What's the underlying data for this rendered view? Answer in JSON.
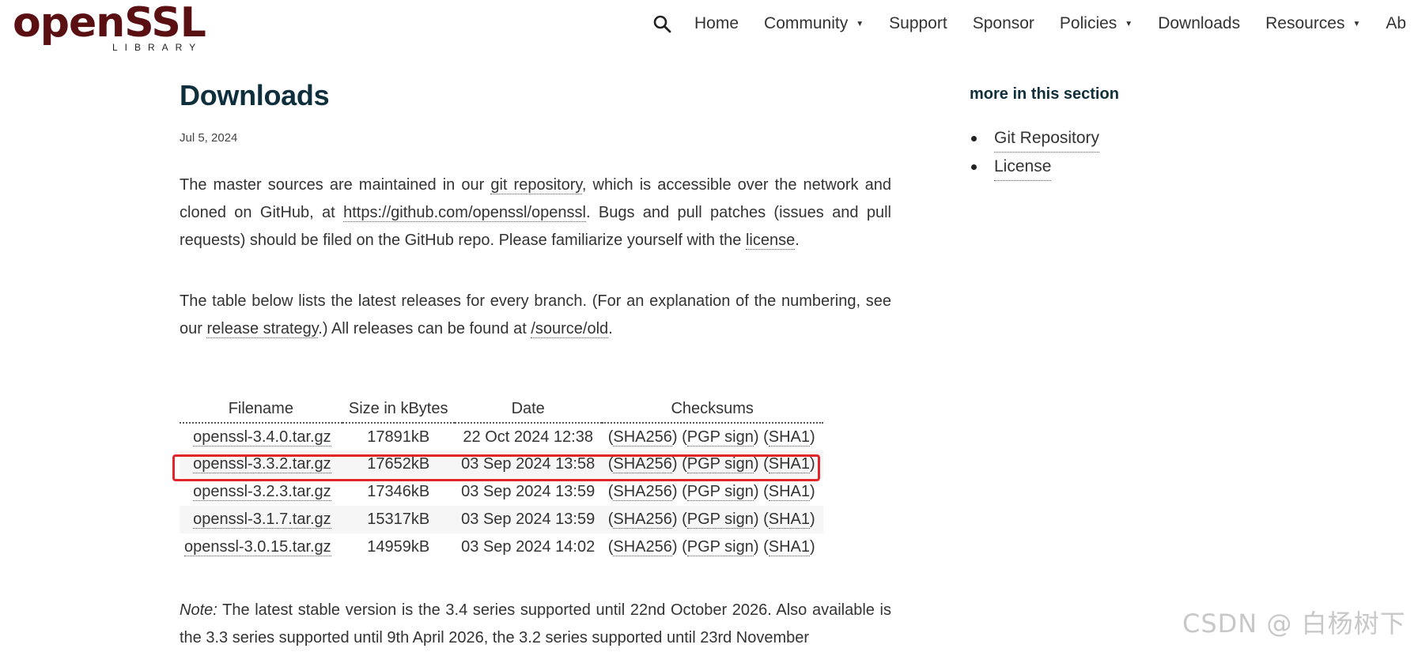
{
  "header": {
    "logo": {
      "text": "openSSL",
      "subtext": "LIBRARY"
    },
    "nav": [
      {
        "label": "Home",
        "dropdown": false
      },
      {
        "label": "Community",
        "dropdown": true
      },
      {
        "label": "Support",
        "dropdown": false
      },
      {
        "label": "Sponsor",
        "dropdown": false
      },
      {
        "label": "Policies",
        "dropdown": true
      },
      {
        "label": "Downloads",
        "dropdown": false
      },
      {
        "label": "Resources",
        "dropdown": true
      },
      {
        "label": "Ab",
        "dropdown": false
      }
    ],
    "caret": "▼"
  },
  "main": {
    "title": "Downloads",
    "date": "Jul 5, 2024",
    "para1": {
      "t1": "The master sources are maintained in our ",
      "link1": "git repository",
      "t2": ", which is accessible over the network and cloned on GitHub, at ",
      "link2": "https://github.com/openssl/openssl",
      "t3": ". Bugs and pull patches (issues and pull requests) should be filed on the GitHub repo. Please familiarize yourself with the ",
      "link3": "license",
      "t4": "."
    },
    "para2": {
      "t1": "The table below lists the latest releases for every branch. (For an explanation of the numbering, see our ",
      "link1": "release strategy",
      "t2": ".) All releases can be found at ",
      "link2": "/source/old",
      "t3": "."
    },
    "table": {
      "headers": [
        "Filename",
        "Size in kBytes",
        "Date",
        "Checksums"
      ],
      "rows": [
        {
          "filename": "openssl-3.4.0.tar.gz",
          "size": "17891kB",
          "date": "22 Oct 2024 12:38"
        },
        {
          "filename": "openssl-3.3.2.tar.gz",
          "size": "17652kB",
          "date": "03 Sep 2024 13:58"
        },
        {
          "filename": "openssl-3.2.3.tar.gz",
          "size": "17346kB",
          "date": "03 Sep 2024 13:59"
        },
        {
          "filename": "openssl-3.1.7.tar.gz",
          "size": "15317kB",
          "date": "03 Sep 2024 13:59"
        },
        {
          "filename": "openssl-3.0.15.tar.gz",
          "size": "14959kB",
          "date": "03 Sep 2024 14:02"
        }
      ],
      "checksum_links": [
        "SHA256",
        "PGP sign",
        "SHA1"
      ]
    },
    "note": {
      "label": "Note:",
      "text": " The latest stable version is the 3.4 series supported until 22nd October 2026. Also available is the 3.3 series supported until 9th April 2026, the 3.2 series supported until 23rd November"
    }
  },
  "sidebar": {
    "title": "more in this section",
    "items": [
      "Git Repository",
      "License"
    ]
  },
  "watermark": "CSDN @ 白杨树下",
  "colors": {
    "title": "#102f3d",
    "highlight": "#e0262b",
    "logo": "#5a0f12"
  }
}
